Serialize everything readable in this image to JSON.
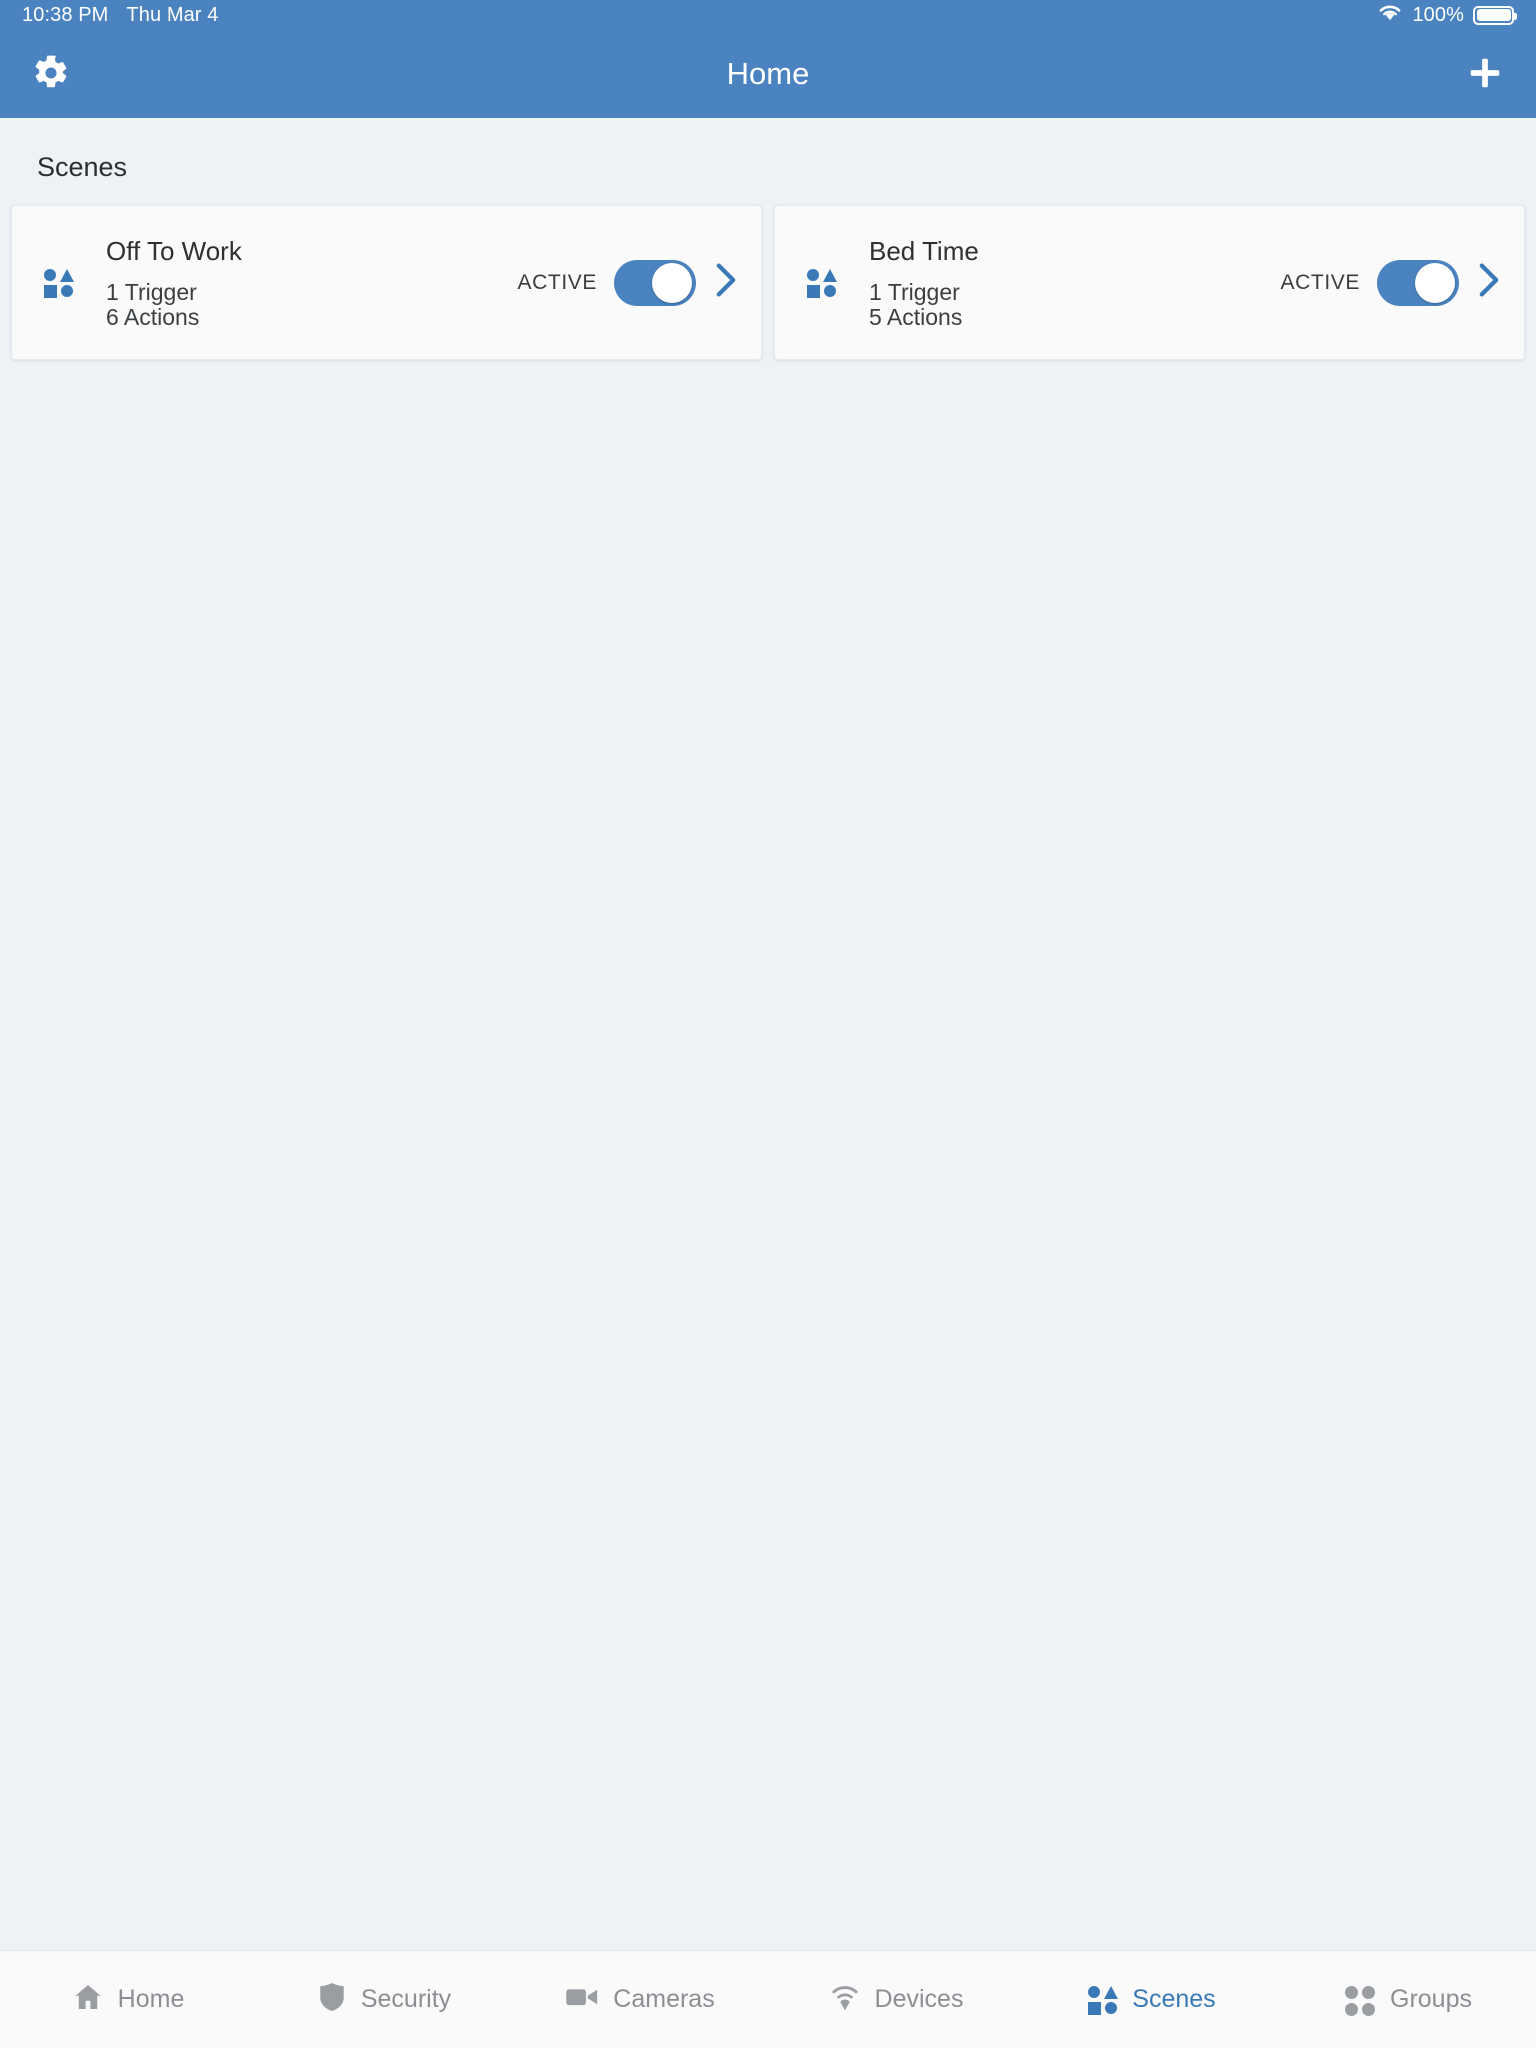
{
  "status_bar": {
    "time": "10:38 PM",
    "date": "Thu Mar 4",
    "battery_percent": "100%",
    "wifi_icon": "wifi-icon",
    "battery_icon": "battery-icon"
  },
  "nav_bar": {
    "title": "Home",
    "settings_icon": "gear-icon",
    "add_icon": "plus-icon"
  },
  "main": {
    "section_title": "Scenes",
    "scenes": [
      {
        "name": "Off To Work",
        "trigger_text": "1 Trigger",
        "actions_text": "6 Actions",
        "status_label": "ACTIVE",
        "toggle_on": true,
        "icon": "scenes-shapes-icon",
        "chevron_icon": "chevron-right-icon"
      },
      {
        "name": "Bed Time",
        "trigger_text": "1 Trigger",
        "actions_text": "5 Actions",
        "status_label": "ACTIVE",
        "toggle_on": true,
        "icon": "scenes-shapes-icon",
        "chevron_icon": "chevron-right-icon"
      }
    ]
  },
  "tab_bar": {
    "items": [
      {
        "label": "Home",
        "icon": "house-icon",
        "active": false
      },
      {
        "label": "Security",
        "icon": "shield-icon",
        "active": false
      },
      {
        "label": "Cameras",
        "icon": "video-camera-icon",
        "active": false
      },
      {
        "label": "Devices",
        "icon": "signal-icon",
        "active": false
      },
      {
        "label": "Scenes",
        "icon": "scenes-shapes-icon",
        "active": true
      },
      {
        "label": "Groups",
        "icon": "groups-dots-icon",
        "active": false
      }
    ]
  },
  "colors": {
    "accent_blue": "#4a83bf",
    "tab_active_blue": "#3a79b8",
    "page_background": "#eef2f5",
    "card_background": "#fafafa",
    "tab_inactive_gray": "#8b8f93"
  }
}
